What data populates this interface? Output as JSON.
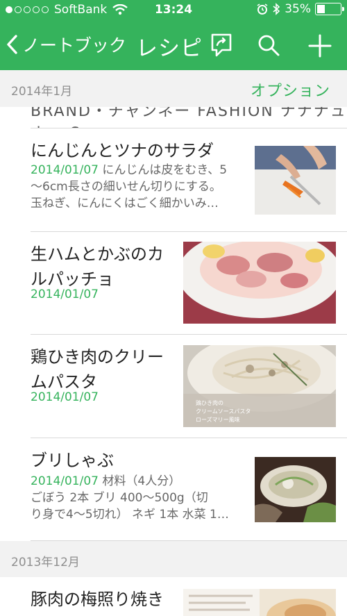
{
  "status_bar": {
    "carrier": "SoftBank",
    "time": "13:24",
    "battery": "35%",
    "battery_level": 0.35
  },
  "nav": {
    "back_label": "ノートブック",
    "title": "レシピ",
    "icons": [
      "chevron-left-icon",
      "share-icon",
      "search-icon",
      "plus-icon"
    ]
  },
  "sections": [
    {
      "date": "2014年1月",
      "option": "オプション"
    },
    {
      "date": "2013年12月"
    }
  ],
  "cutoff_text": "BRAND・チャンネー FASHION ナナナュナー S…",
  "notes": [
    {
      "title": "にんじんとツナのサラダ",
      "date": "2014/01/07",
      "snippet_line1": "にんじんは皮をむき、5",
      "snippet_line2": "〜6cm長さの細いせん切りにする。",
      "snippet_line3": "玉ねぎ、にんにくはごく細かいみ…"
    },
    {
      "title_line1": "生ハムとかぶのカ",
      "title_line2": "ルパッチョ",
      "date": "2014/01/07"
    },
    {
      "title_line1": "鶏ひき肉のクリー",
      "title_line2": "ムパスタ",
      "date": "2014/01/07",
      "image_caption1": "鶏ひき肉の",
      "image_caption2": "クリームソースパスタ",
      "image_caption3": "ローズマリー風味"
    },
    {
      "title": "ブリしゃぶ",
      "date": "2014/01/07",
      "snippet_line1": "材料（4人分）",
      "snippet_line2": "ごぼう 2本 ブリ 400〜500g（切",
      "snippet_line3": "り身で4〜5切れ） ネギ 1本 水菜 1…"
    },
    {
      "title": "豚肉の梅照り焼き"
    }
  ],
  "colors": {
    "accent": "#35b35c",
    "section_bg": "#f2f2f2",
    "date_gray": "#8e8e8e"
  }
}
